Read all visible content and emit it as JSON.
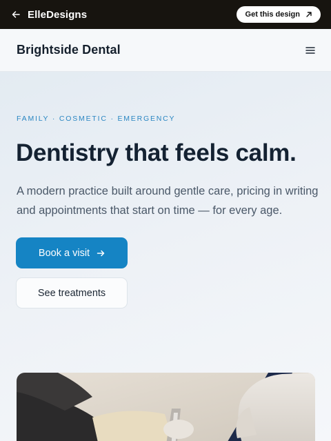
{
  "topbar": {
    "brand": "ElleDesigns",
    "cta_label": "Get this design"
  },
  "nav": {
    "logo": "Brightside Dental"
  },
  "hero": {
    "eyebrow": "FAMILY · COSMETIC · EMERGENCY",
    "headline": "Dentistry that feels calm.",
    "lede": "A modern practice built around gentle care, pricing in writing and appointments that start on time — for every age.",
    "primary_button": "Book a visit",
    "secondary_button": "See treatments"
  },
  "colors": {
    "topbar_bg": "#17140f",
    "accent": "#1584c4",
    "eyebrow": "#2a86c2",
    "heading": "#142232"
  },
  "icons": [
    "arrow-left-icon",
    "arrow-up-right-icon",
    "hamburger-menu-icon",
    "arrow-right-icon"
  ]
}
